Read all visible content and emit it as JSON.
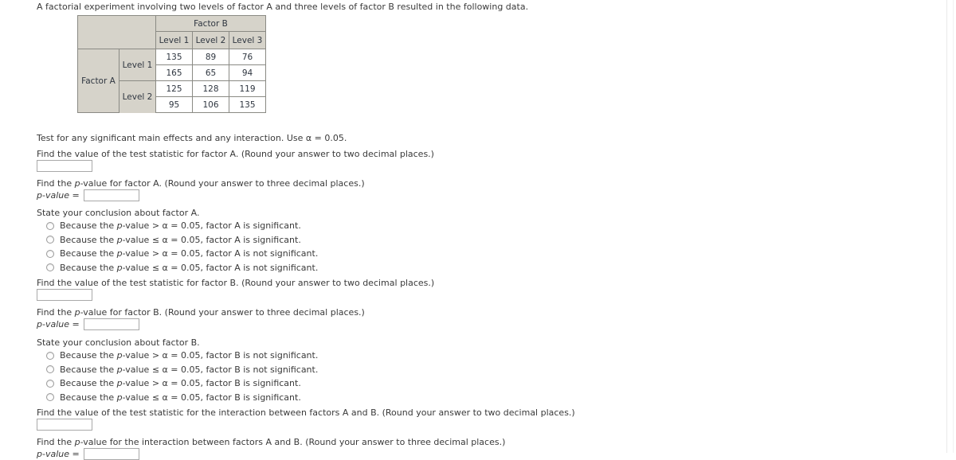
{
  "intro": "A factorial experiment involving two levels of factor A and three levels of factor B resulted in the following data.",
  "table": {
    "factor_b_header": "Factor B",
    "factor_a_header": "Factor A",
    "b_levels": [
      "Level 1",
      "Level 2",
      "Level 3"
    ],
    "a_levels": [
      "Level 1",
      "Level 2"
    ],
    "rows": [
      {
        "a_level": "Level 1",
        "values": [
          [
            "135",
            "89",
            "76"
          ],
          [
            "165",
            "65",
            "94"
          ]
        ]
      },
      {
        "a_level": "Level 2",
        "values": [
          [
            "125",
            "128",
            "119"
          ],
          [
            "95",
            "106",
            "135"
          ]
        ]
      }
    ]
  },
  "instruction": "Test for any significant main effects and any interaction. Use α = 0.05.",
  "sections": {
    "factor_a_statistic": {
      "prompt": "Find the value of the test statistic for factor A. (Round your answer to two decimal places.)",
      "value": "",
      "placeholder": ""
    },
    "factor_a_pvalue": {
      "prompt": "Find the p-value for factor A. (Round your answer to three decimal places.)",
      "label": "p-value =",
      "value": "",
      "placeholder": ""
    },
    "factor_a_conclusion": {
      "prompt": "State your conclusion about factor A.",
      "options": [
        "Because the p-value > α = 0.05, factor A is significant.",
        "Because the p-value ≤ α = 0.05, factor A is significant.",
        "Because the p-value > α = 0.05, factor A is not significant.",
        "Because the p-value ≤ α = 0.05, factor A is not significant."
      ],
      "selected": -1
    },
    "factor_b_statistic": {
      "prompt": "Find the value of the test statistic for factor B. (Round your answer to two decimal places.)",
      "value": "",
      "placeholder": ""
    },
    "factor_b_pvalue": {
      "prompt": "Find the p-value for factor B. (Round your answer to three decimal places.)",
      "label": "p-value =",
      "value": "",
      "placeholder": ""
    },
    "factor_b_conclusion": {
      "prompt": "State your conclusion about factor B.",
      "options": [
        "Because the p-value > α = 0.05, factor B is not significant.",
        "Because the p-value ≤ α = 0.05, factor B is not significant.",
        "Because the p-value > α = 0.05, factor B is significant.",
        "Because the p-value ≤ α = 0.05, factor B is significant."
      ],
      "selected": -1
    },
    "interaction_statistic": {
      "prompt": "Find the value of the test statistic for the interaction between factors A and B. (Round your answer to two decimal places.)",
      "value": "",
      "placeholder": ""
    },
    "interaction_pvalue": {
      "prompt": "Find the p-value for the interaction between factors A and B. (Round your answer to three decimal places.)",
      "label": "p-value =",
      "value": "",
      "placeholder": ""
    }
  },
  "colors": {
    "header_fill": "#d6d3ca",
    "cell_border": "#8a8a84",
    "text": "#3a3a3a",
    "input_border": "#a9a9a9"
  }
}
